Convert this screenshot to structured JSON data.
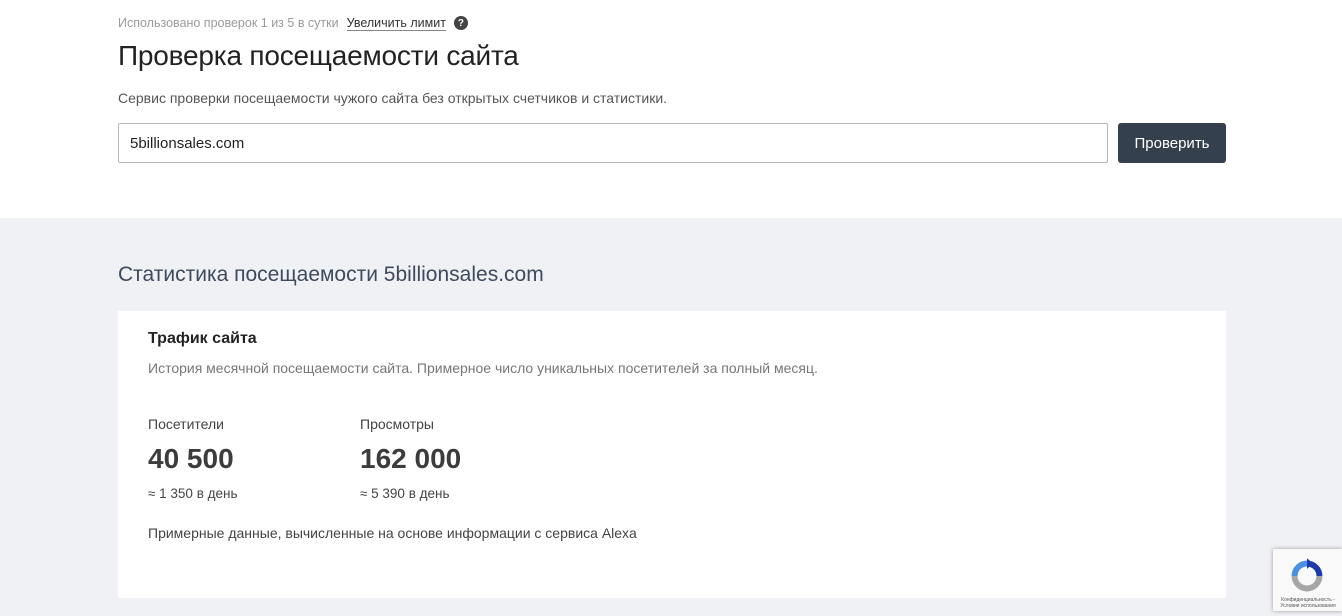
{
  "limit": {
    "usage_text": "Использовано проверок 1 из 5 в сутки",
    "increase_link": "Увеличить лимит",
    "help_icon": "question-icon"
  },
  "header": {
    "title": "Проверка посещаемости сайта",
    "subtitle": "Сервис проверки посещаемости чужого сайта без открытых счетчиков и статистики."
  },
  "search": {
    "value": "5billionsales.com",
    "button_label": "Проверить"
  },
  "stats": {
    "heading": "Статистика посещаемости 5billionsales.com",
    "card_title": "Трафик сайта",
    "card_description": "История месячной посещаемости сайта. Примерное число уникальных посетителей за полный месяц.",
    "visitors": {
      "label": "Посетители",
      "value": "40 500",
      "per_day": "≈ 1 350 в день"
    },
    "views": {
      "label": "Просмотры",
      "value": "162 000",
      "per_day": "≈ 5 390 в день"
    },
    "note": "Примерные данные, вычисленные на основе информации с сервиса Alexa"
  },
  "recaptcha": {
    "icon": "recaptcha-icon",
    "text": "Конфиденциальность - Условия использования"
  },
  "colors": {
    "button_bg": "#34404d",
    "section_bg": "#f0f1f5",
    "heading_color": "#3d4a5c"
  }
}
